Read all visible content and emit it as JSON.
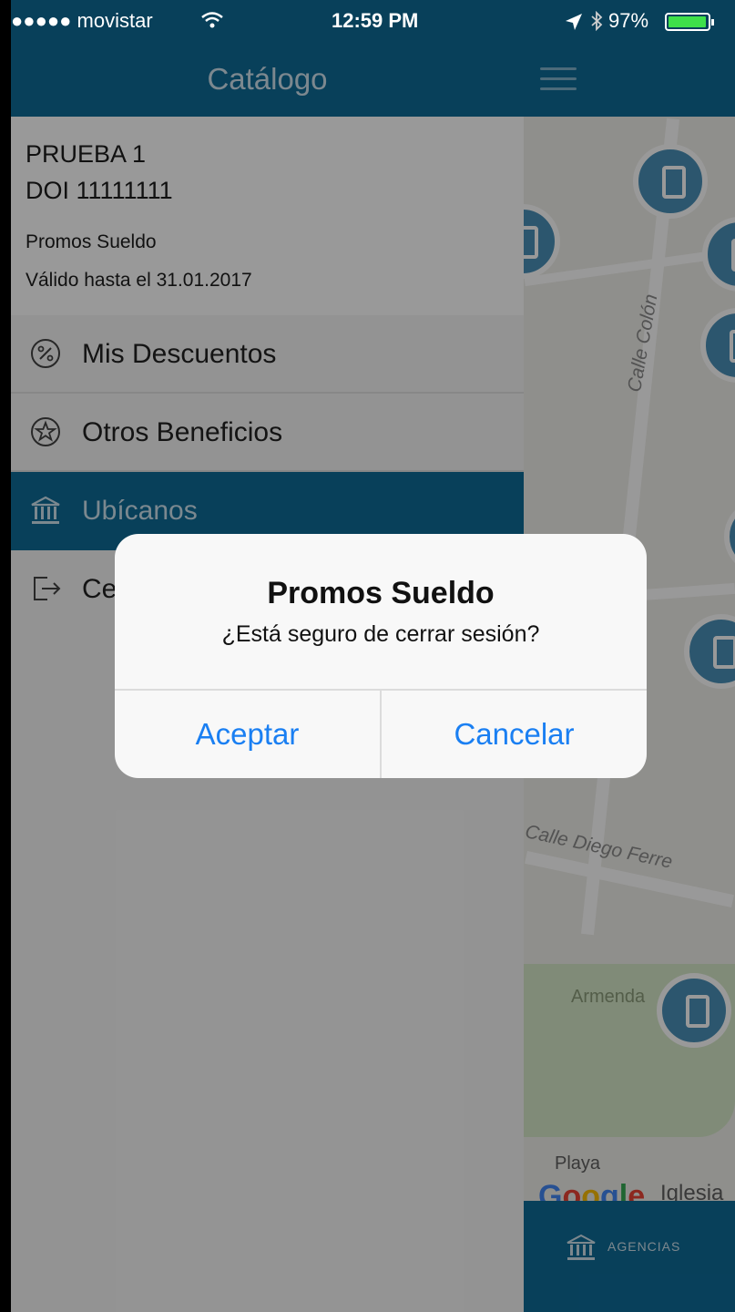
{
  "status_bar": {
    "carrier": "●●●●● movistar",
    "time": "12:59 PM",
    "battery": "97%",
    "battery_level": 0.97
  },
  "drawer": {
    "title": "Catálogo",
    "profile": {
      "name": "PRUEBA 1",
      "doi": "DOI 11111111",
      "promo": "Promos Sueldo",
      "valid_until": "Válido hasta el 31.01.2017"
    },
    "items": [
      {
        "label": "Mis Descuentos",
        "icon": "percent-icon",
        "active": false
      },
      {
        "label": "Otros Beneficios",
        "icon": "star-icon",
        "active": false
      },
      {
        "label": "Ubícanos",
        "icon": "bank-icon",
        "active": true
      },
      {
        "label": "Ce",
        "icon": "logout-icon",
        "active": false
      }
    ]
  },
  "map": {
    "street_labels": [
      "Calle Colón",
      "Calle Diego Ferre"
    ],
    "place_labels": [
      "Armenda",
      "Playa",
      "Iglesia"
    ],
    "google_logo": "Google",
    "footer_label": "AGENCIAS",
    "colors": {
      "header": "#0e6b97",
      "pin": "#4a90b8"
    }
  },
  "alert": {
    "title": "Promos Sueldo",
    "message": "¿Está seguro de cerrar sesión?",
    "accept_label": "Aceptar",
    "cancel_label": "Cancelar",
    "button_color": "#1a7ff2"
  }
}
